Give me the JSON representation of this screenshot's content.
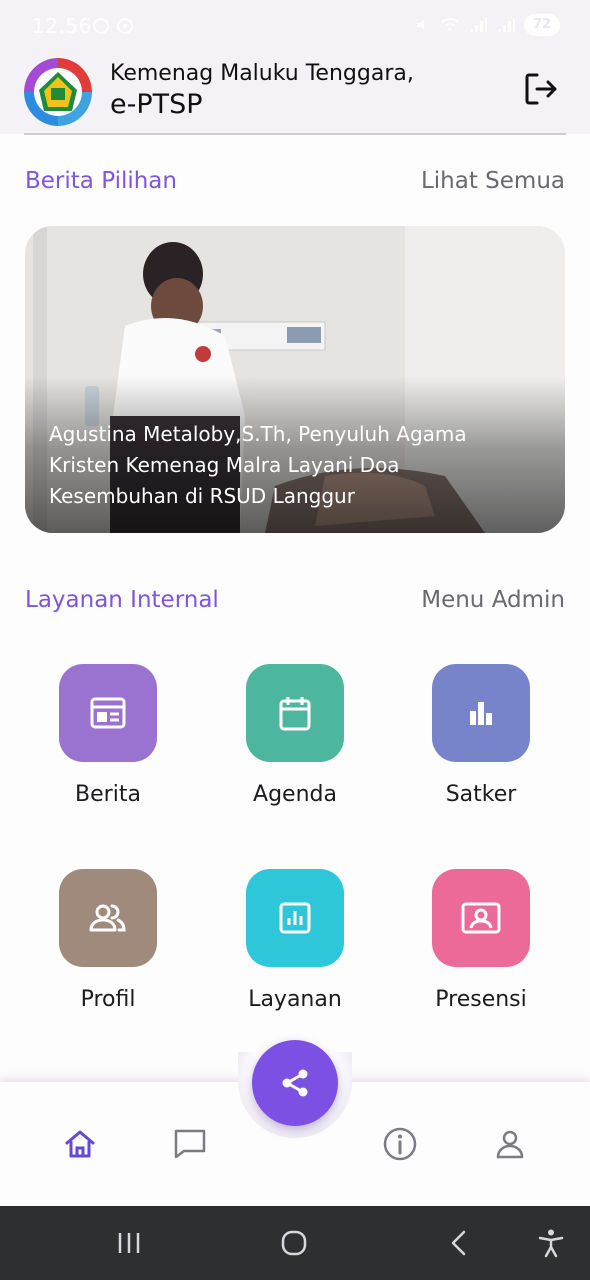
{
  "status_bar": {
    "time": "12.56",
    "battery": "72",
    "left_icons": [
      "message-icon",
      "whatsapp-icon",
      "whatsapp-icon"
    ],
    "right_icons": [
      "mute-icon",
      "wifi-icon",
      "signal-icon",
      "signal-icon"
    ]
  },
  "header": {
    "title": "Kemenag Maluku Tenggara,",
    "subtitle": "e-PTSP",
    "logo_icon": "kemenag-logo",
    "logout_icon": "logout-icon"
  },
  "featured": {
    "title": "Berita Pilihan",
    "see_all": "Lihat Semua",
    "news_caption": "Agustina Metaloby,S.Th, Penyuluh Agama Kristen Kemenag Malra Layani Doa Kesembuhan di RSUD Langgur"
  },
  "services": {
    "title": "Layanan Internal",
    "admin_link": "Menu Admin",
    "items": [
      {
        "label": "Berita",
        "icon": "newspaper-icon",
        "color": "#9a72cf"
      },
      {
        "label": "Agenda",
        "icon": "calendar-icon",
        "color": "#4cb79e"
      },
      {
        "label": "Satker",
        "icon": "bar-chart-icon",
        "color": "#7784c9"
      },
      {
        "label": "Profil",
        "icon": "users-icon",
        "color": "#a08a7c"
      },
      {
        "label": "Layanan",
        "icon": "chart-box-icon",
        "color": "#2ec7da"
      },
      {
        "label": "Presensi",
        "icon": "id-card-icon",
        "color": "#ec6a98"
      }
    ]
  },
  "bottom_nav": {
    "items": [
      "home-icon",
      "chat-icon",
      "share-icon",
      "info-icon",
      "user-icon"
    ],
    "active": "home-icon",
    "accent": "#7b50e3"
  },
  "system_nav": [
    "recents-icon",
    "home-circle-icon",
    "back-icon",
    "accessibility-icon"
  ]
}
